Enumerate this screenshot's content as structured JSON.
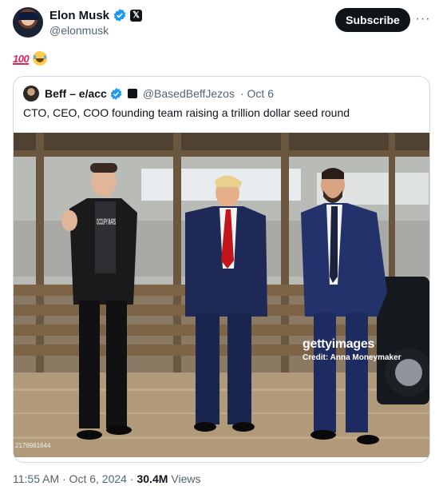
{
  "author": {
    "name": "Elon Musk",
    "handle": "@elonmusk"
  },
  "subscribe_label": "Subscribe",
  "more_label": "···",
  "tweet": {
    "emojis": [
      "100-emoji",
      "tears-of-joy-emoji"
    ],
    "emoji_100_text": "100"
  },
  "quoted": {
    "name": "Beff – e/acc",
    "handle": "@BasedBeffJezos",
    "date": "· Oct 6",
    "text": "CTO, CEO, COO founding team raising a trillion dollar seed round",
    "photo": {
      "watermark_brand": "gettyimages",
      "credit": "Credit: Anna Moneymaker",
      "image_id": "2176981644",
      "shirt_text": "OCCUPY MARS"
    }
  },
  "meta": {
    "time": "11:55 AM · Oct 6, 2024 ·",
    "views_count": "30.4M",
    "views_label": "Views"
  },
  "colors": {
    "verified": "#1d9bf0",
    "text_primary": "#0f1419",
    "text_secondary": "#536471",
    "border": "#cfd9de"
  }
}
